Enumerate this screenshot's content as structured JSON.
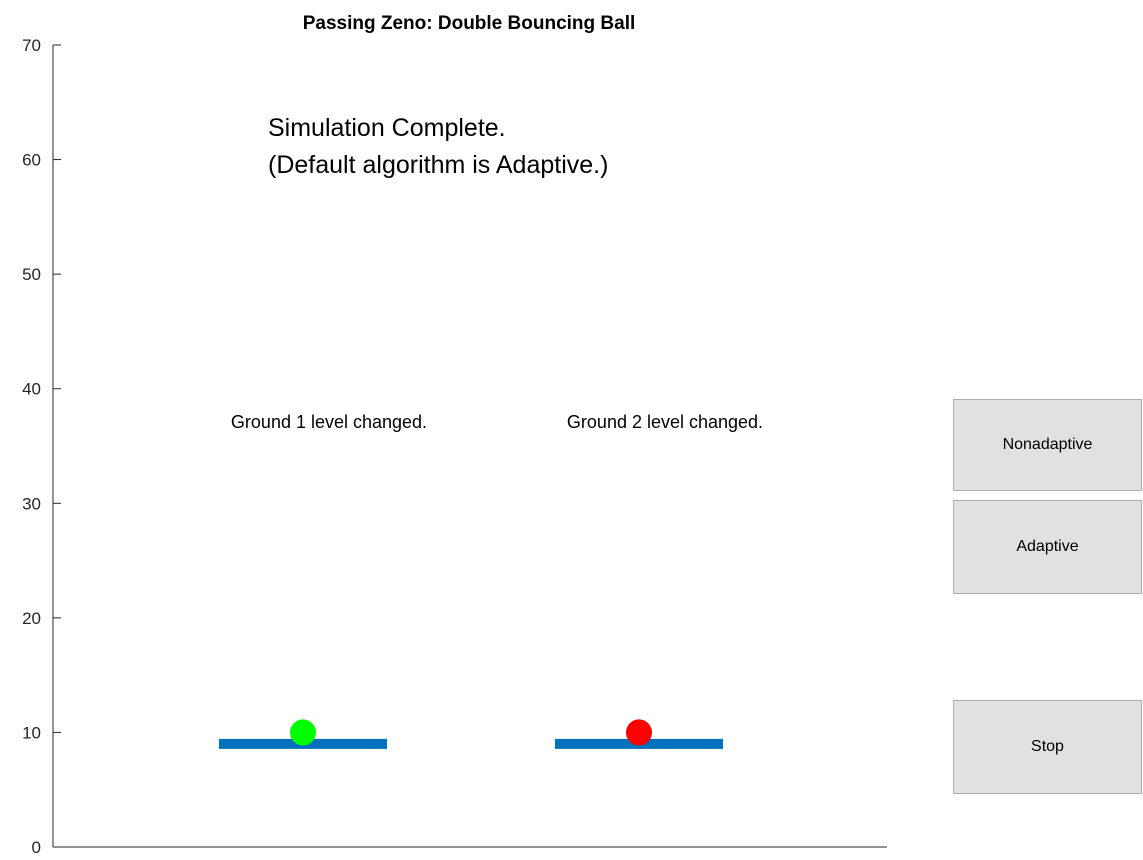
{
  "figure": {
    "title": "Passing Zeno: Double Bouncing Ball",
    "status_line_1": "Simulation Complete.",
    "status_line_2": "(Default algorithm is Adaptive.)",
    "ground1_message": "Ground 1 level changed.",
    "ground2_message": "Ground 2 level changed."
  },
  "axes": {
    "y_ticks": [
      "0",
      "10",
      "20",
      "30",
      "40",
      "50",
      "60",
      "70"
    ],
    "ylim": [
      0,
      70
    ]
  },
  "scene": {
    "ball1": {
      "color": "#00ff00",
      "y": 10
    },
    "ball2": {
      "color": "#ff0000",
      "y": 10
    },
    "ground_color": "#0072bd",
    "ground1_level": 9,
    "ground2_level": 9
  },
  "buttons": {
    "nonadaptive_label": "Nonadaptive",
    "adaptive_label": "Adaptive",
    "stop_label": "Stop"
  }
}
